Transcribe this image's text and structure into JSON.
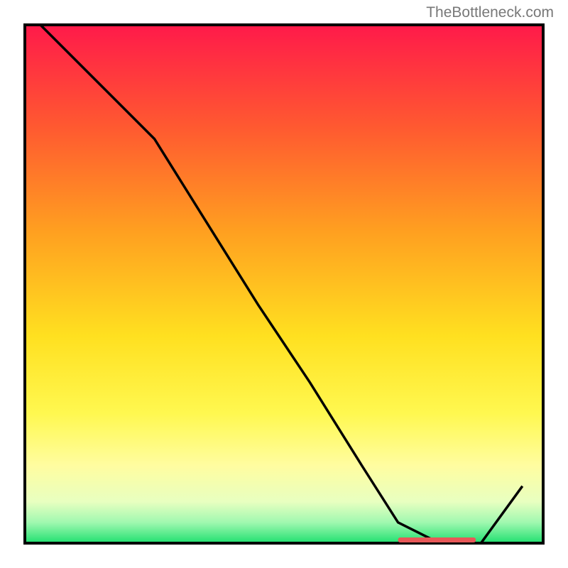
{
  "watermark": "TheBottleneck.com",
  "chart_data": {
    "type": "line",
    "title": "",
    "xlabel": "",
    "ylabel": "",
    "xlim": [
      0,
      100
    ],
    "ylim": [
      0,
      100
    ],
    "series": [
      {
        "name": "curve",
        "x": [
          3,
          15,
          25,
          35,
          45,
          55,
          65,
          72,
          80,
          88,
          96
        ],
        "y": [
          100,
          88,
          78,
          62,
          46,
          31,
          15,
          4,
          0,
          0,
          11
        ]
      }
    ],
    "gradient_stops": [
      {
        "offset": 0,
        "color": "#ff1a4a"
      },
      {
        "offset": 20,
        "color": "#ff5a30"
      },
      {
        "offset": 40,
        "color": "#ffa020"
      },
      {
        "offset": 60,
        "color": "#ffe020"
      },
      {
        "offset": 75,
        "color": "#fff850"
      },
      {
        "offset": 85,
        "color": "#fffda0"
      },
      {
        "offset": 92,
        "color": "#e8ffc0"
      },
      {
        "offset": 96,
        "color": "#a0f8b0"
      },
      {
        "offset": 100,
        "color": "#20e070"
      }
    ],
    "marker": {
      "x_start": 72,
      "x_end": 87,
      "color": "#e85858"
    }
  }
}
